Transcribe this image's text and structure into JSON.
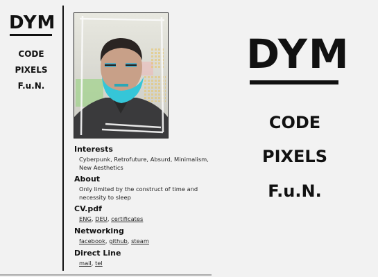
{
  "brand": {
    "logo": "DYM"
  },
  "nav": [
    {
      "label": "CODE"
    },
    {
      "label": "PIXELS"
    },
    {
      "label": "F.u.N."
    }
  ],
  "sections": {
    "interests": {
      "title": "Interests",
      "text": "Cyberpunk, Retrofuture, Absurd, Minimalism, New Aesthetics"
    },
    "about": {
      "title": "About",
      "text": "Only limited by the construct of time and necessity to sleep"
    },
    "cv": {
      "title": "CV.pdf",
      "links": [
        "ENG",
        "DEU",
        "certificates"
      ]
    },
    "networking": {
      "title": "Networking",
      "links": [
        "facebook",
        "github",
        "steam"
      ]
    },
    "direct": {
      "title": "Direct Line",
      "links": [
        "mail",
        "tel"
      ]
    }
  },
  "colors": {
    "background": "#f2f2f2",
    "ink": "#111111",
    "beard_accent": "#35c6d8"
  }
}
